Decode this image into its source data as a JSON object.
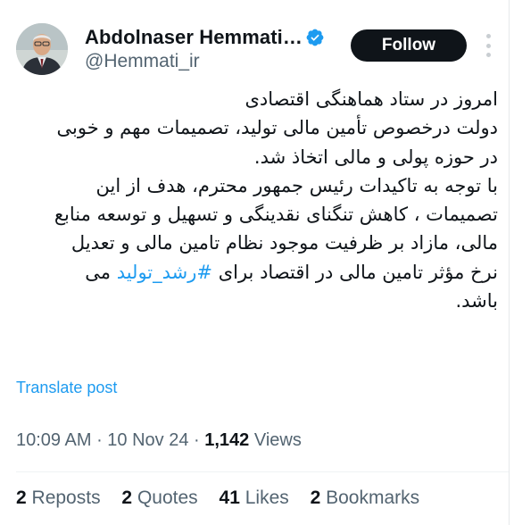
{
  "author": {
    "name": "Abdolnaser Hemmati…",
    "handle": "@Hemmati_ir",
    "verified": true,
    "avatar": "profile-photo"
  },
  "actions": {
    "follow_label": "Follow",
    "more_icon": "more-vertical-icon"
  },
  "tweet": {
    "lines": [
      "امروز در ستاد هماهنگی اقتصادی",
      "دولت درخصوص تأمین مالی تولید، تصمیمات مهم و خوبی",
      "در حوزه پولی و مالی اتخاذ شد.",
      "با توجه به تاکیدات رئیس جمهور محترم، هدف از این",
      "تصمیمات ، کاهش تنگنای نقدینگی و تسهیل و توسعه منابع",
      "مالی، مازاد بر ظرفیت موجود نظام تامین مالی و تعدیل"
    ],
    "line7_before": "نرخ مؤثر تامین مالی در اقتصاد برای",
    "hashtag": "#رشد_تولید",
    "line7_after": "می",
    "line8": "باشد.",
    "translate_label": "Translate post"
  },
  "meta": {
    "time": "10:09 AM",
    "sep1": " · ",
    "date": "10 Nov 24",
    "sep2": " · ",
    "views_count": "1,142",
    "views_label": " Views"
  },
  "stats": [
    {
      "count": "2",
      "label": "Reposts"
    },
    {
      "count": "2",
      "label": "Quotes"
    },
    {
      "count": "41",
      "label": "Likes"
    },
    {
      "count": "2",
      "label": "Bookmarks"
    }
  ],
  "colors": {
    "accent": "#1d9bf0",
    "text": "#0f1419",
    "secondary": "#536471",
    "button_bg": "#0f1419"
  }
}
